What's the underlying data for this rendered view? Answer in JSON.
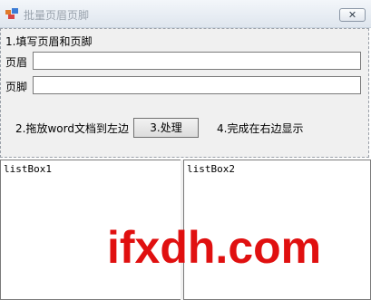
{
  "window": {
    "title": "批量页眉页脚",
    "close_glyph": "✕"
  },
  "form": {
    "step1_label": "1.填写页眉和页脚",
    "header_label": "页眉",
    "header_value": "",
    "footer_label": "页脚",
    "footer_value": "",
    "step2_label": "2.拖放word文档到左边",
    "process_button": "3.处理",
    "step4_label": "4.完成在右边显示"
  },
  "lists": {
    "left_name": "listBox1",
    "right_name": "listBox2"
  },
  "watermark": "ifxdh.com",
  "colors": {
    "watermark": "#e01010",
    "panel_bg": "#f0f0f0"
  }
}
